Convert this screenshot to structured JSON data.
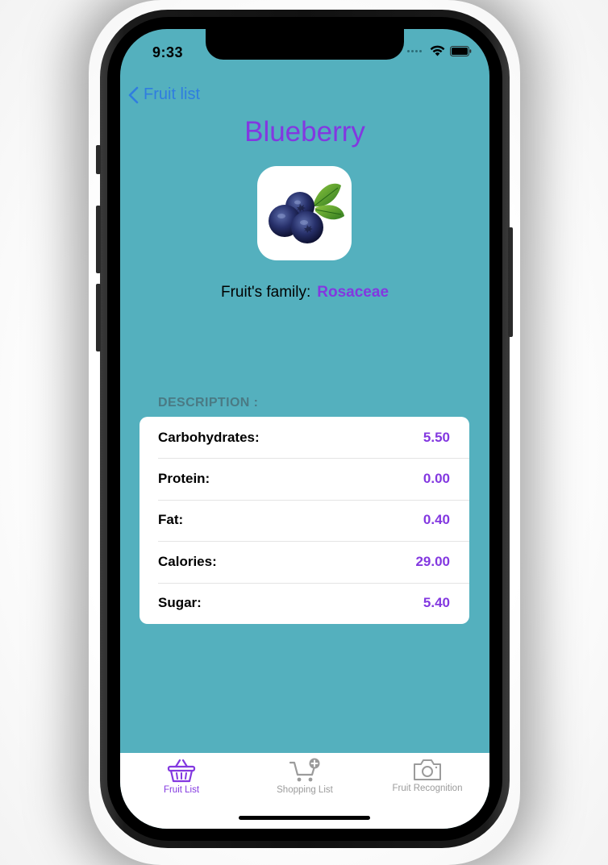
{
  "status_bar": {
    "time": "9:33"
  },
  "nav": {
    "back_label": "Fruit list"
  },
  "fruit": {
    "name": "Blueberry",
    "family_label": "Fruit's family:",
    "family_value": "Rosaceae",
    "image": "blueberry-image"
  },
  "description": {
    "header": "DESCRIPTION :",
    "rows": [
      {
        "label": "Carbohydrates:",
        "value": "5.50"
      },
      {
        "label": "Protein:",
        "value": "0.00"
      },
      {
        "label": "Fat:",
        "value": "0.40"
      },
      {
        "label": "Calories:",
        "value": "29.00"
      },
      {
        "label": "Sugar:",
        "value": "5.40"
      }
    ]
  },
  "tabs": [
    {
      "label": "Fruit List",
      "icon": "basket-icon",
      "active": true
    },
    {
      "label": "Shopping List",
      "icon": "cart-plus-icon",
      "active": false
    },
    {
      "label": "Fruit Recognition",
      "icon": "camera-icon",
      "active": false
    }
  ],
  "colors": {
    "background": "#54b0be",
    "accent": "#8338e0",
    "link": "#2f7de0",
    "inactive_tab": "#9b9b9b"
  }
}
